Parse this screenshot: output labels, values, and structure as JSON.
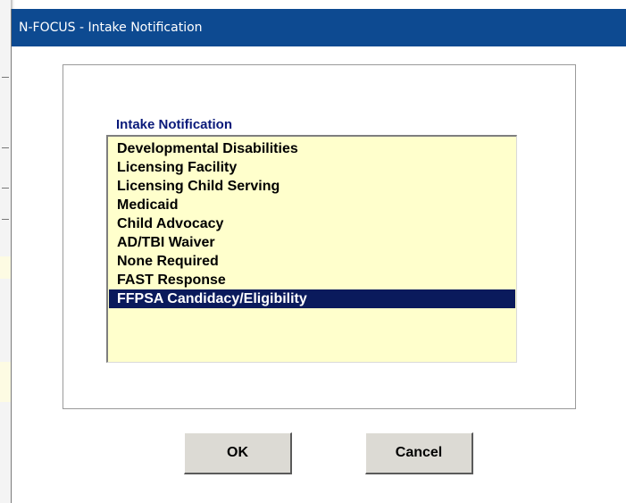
{
  "window": {
    "title": "N-FOCUS - Intake Notification"
  },
  "group": {
    "label": "Intake Notification"
  },
  "list": {
    "items": [
      "Developmental Disabilities",
      "Licensing Facility",
      "Licensing Child Serving",
      "Medicaid",
      "Child Advocacy",
      "AD/TBI Waiver",
      "None Required",
      "FAST Response",
      "FFPSA Candidacy/Eligibility"
    ],
    "selected_index": 8
  },
  "buttons": {
    "ok": "OK",
    "cancel": "Cancel"
  },
  "colors": {
    "titlebar": "#0d4a91",
    "listbox_bg": "#ffffcc",
    "selection": "#0a1a5c",
    "label": "#0a1a7a"
  }
}
